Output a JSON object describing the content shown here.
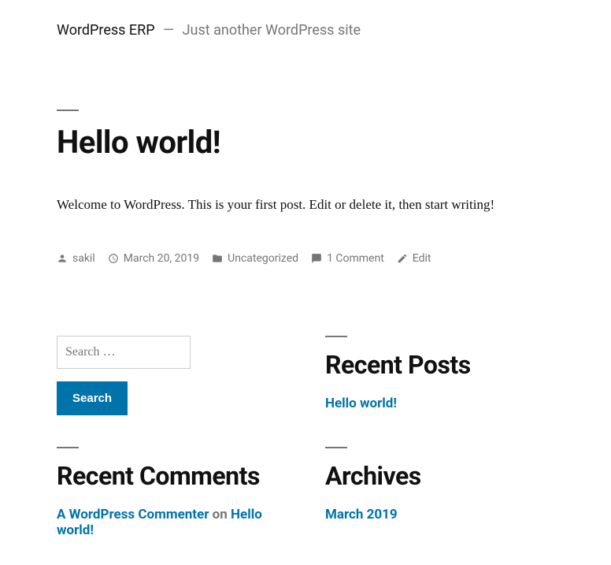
{
  "header": {
    "site_title": "WordPress ERP",
    "tagline_dash": "—",
    "tagline": "Just another WordPress site"
  },
  "post": {
    "title": "Hello world!",
    "content": "Welcome to WordPress. This is your first post. Edit or delete it, then start writing!",
    "meta": {
      "author": "sakil",
      "date": "March 20, 2019",
      "category": "Uncategorized",
      "comments": "1 Comment",
      "edit": "Edit"
    }
  },
  "search": {
    "placeholder": "Search …",
    "button": "Search"
  },
  "widgets": {
    "recent_posts": {
      "title": "Recent Posts",
      "items": [
        "Hello world!"
      ]
    },
    "recent_comments": {
      "title": "Recent Comments",
      "item": {
        "author": "A WordPress Commenter",
        "on": " on ",
        "post": "Hello world!"
      }
    },
    "archives": {
      "title": "Archives",
      "items": [
        "March 2019"
      ]
    }
  }
}
